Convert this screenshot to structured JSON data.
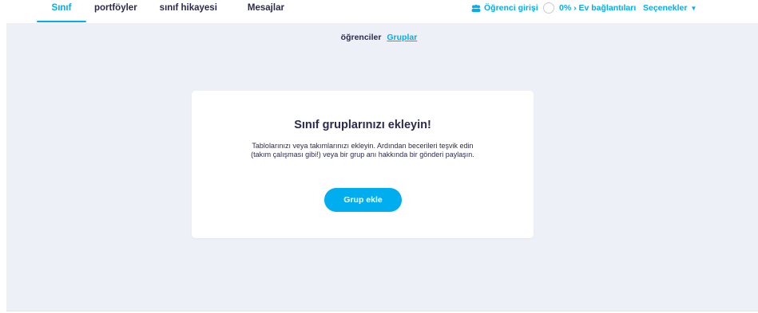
{
  "nav": {
    "tabs": [
      {
        "label": "Sınıf",
        "active": true
      },
      {
        "label": "portföyler",
        "active": false
      },
      {
        "label": "sınıf hikayesi",
        "active": false
      },
      {
        "label": "Mesajlar",
        "active": false
      }
    ],
    "student_login": {
      "label": "Öğrenci girişi",
      "icon": "students-icon"
    },
    "home_connections": {
      "label": "0% › Ev bağlantıları",
      "progress": 0,
      "icon": "progress-ring-icon"
    },
    "options": {
      "label": "Seçenekler",
      "icon": "caret-down-icon"
    }
  },
  "subtabs": {
    "students": "öğrenciler",
    "groups": "Gruplar",
    "active": "groups"
  },
  "empty_state": {
    "title": "Sınıf gruplarınızı ekleyin!",
    "description": "Tablolarınızı veya takımlarınızı ekleyin. Ardından becerileri teşvik edin (takım çalışması gibi!) veya bir grup anı hakkında bir gönderi paylaşın.",
    "button_label": "Grup ekle"
  },
  "colors": {
    "accent": "#00aef0",
    "text": "#2c2a50",
    "background": "#eef0f7",
    "card": "#ffffff"
  }
}
